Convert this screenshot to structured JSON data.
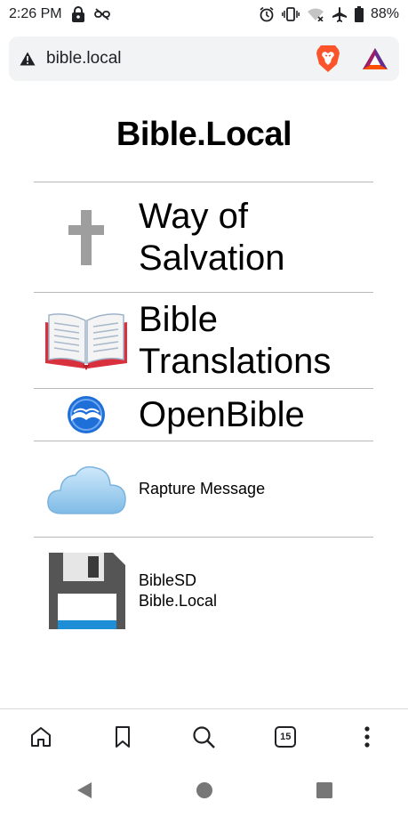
{
  "status": {
    "time": "2:26 PM",
    "battery": "88%"
  },
  "browser": {
    "url": "bible.local",
    "tab_count": "15"
  },
  "page": {
    "title": "Bible.Local",
    "items": [
      {
        "label": "Way of Salvation",
        "icon": "cross-icon"
      },
      {
        "label": "Bible Translations",
        "icon": "open-book-icon"
      },
      {
        "label": "OpenBible",
        "icon": "openbible-logo-icon"
      },
      {
        "label": "Rapture Message",
        "icon": "cloud-icon"
      },
      {
        "label": "BibleSD\nBible.Local",
        "line1": "BibleSD",
        "line2": "Bible.Local",
        "icon": "floppy-disk-icon"
      }
    ]
  },
  "colors": {
    "brave": "#fb542b",
    "bat_triangle_left": "#9e1f63",
    "bat_triangle_right": "#662d91",
    "bat_triangle_bottom": "#ff5000",
    "openbible_blue": "#1f6fd8",
    "floppy_body": "#555555",
    "floppy_stripe": "#1e8fd6",
    "cross": "#9e9e9e"
  }
}
